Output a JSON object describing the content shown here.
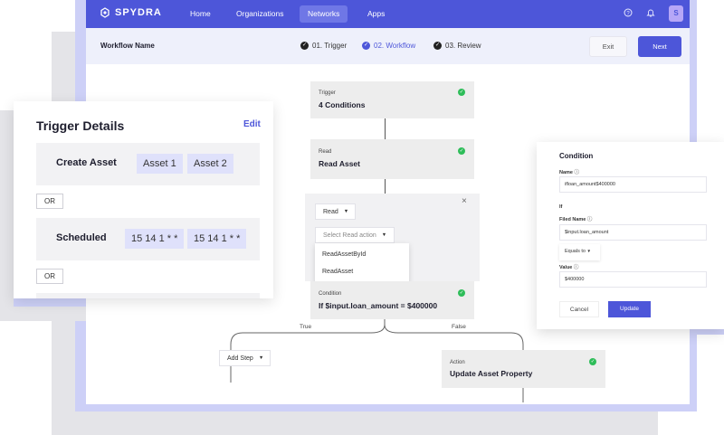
{
  "nav": {
    "brand": "SPYDRA",
    "links": [
      "Home",
      "Organizations",
      "Networks",
      "Apps"
    ],
    "active_link": "Networks",
    "avatar_initial": "S"
  },
  "workflow": {
    "name": "Workflow Name",
    "steps": [
      "01.  Trigger",
      "02.  Workflow",
      "03.  Review"
    ],
    "active_step": "02.  Workflow",
    "exit_label": "Exit",
    "next_label": "Next"
  },
  "flow": {
    "trigger_node": {
      "label": "Trigger",
      "value": "4 Conditions"
    },
    "read_node": {
      "label": "Read",
      "value": "Read Asset"
    },
    "read_editor": {
      "type_dropdown": "Read",
      "action_placeholder": "Select Read action",
      "menu_items": [
        "ReadAssetById",
        "ReadAsset"
      ],
      "close_icon": "×"
    },
    "condition_node": {
      "label": "Condition",
      "value": "If $input.loan_amount = $400000"
    },
    "branch_true": "True",
    "branch_false": "False",
    "add_step_label": "Add Step",
    "action_node": {
      "label": "Action",
      "value": "Update Asset Property"
    }
  },
  "trigger_details": {
    "title": "Trigger Details",
    "edit_label": "Edit",
    "rows": [
      {
        "name": "Create Asset",
        "chips": [
          "Asset 1",
          "Asset 2"
        ]
      },
      {
        "name": "Scheduled",
        "chips": [
          "15 14 1 * *",
          "15 14 1 * *"
        ]
      }
    ],
    "or_label": "OR"
  },
  "condition_panel": {
    "title": "Condition",
    "name_label": "Name",
    "name_value": "ifloan_amount$400000",
    "if_label": "If",
    "filed_name_label": "Filed Name",
    "filed_name_value": "$input.loan_amount",
    "operator": "Equals to",
    "value_label": "Value",
    "value_value": "$400000",
    "cancel_label": "Cancel",
    "update_label": "Update"
  },
  "colors": {
    "primary": "#4d56d9",
    "success": "#2ebd59",
    "node_bg": "#ededed",
    "chip_bg": "#dfe1fb"
  },
  "icons": [
    "logo-icon",
    "help-icon",
    "bell-icon",
    "check-circle-icon",
    "close-icon",
    "caret-down-icon",
    "info-icon"
  ]
}
